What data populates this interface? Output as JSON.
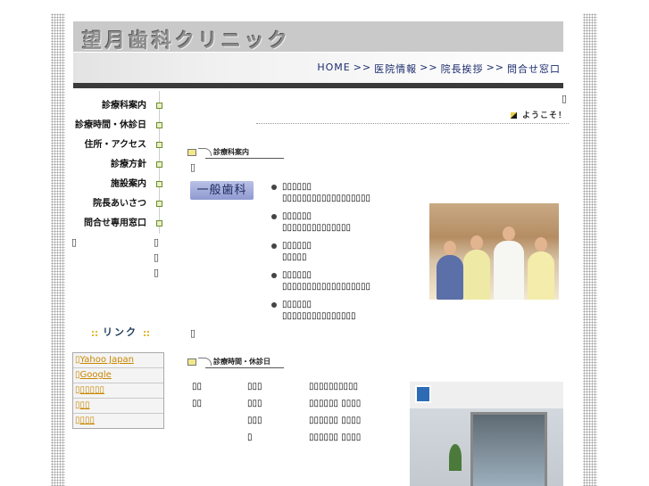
{
  "header": {
    "logo_text": "望月歯科クリニック",
    "nav": [
      {
        "label": "HOME"
      },
      {
        "label": "医院情報"
      },
      {
        "label": "院長挨拶"
      },
      {
        "label": "問合せ窓口"
      }
    ],
    "nav_separator": ">>"
  },
  "sidebar": {
    "menu": [
      {
        "label": "診療科案内"
      },
      {
        "label": "診療時間・休診日"
      },
      {
        "label": "住所・アクセス"
      },
      {
        "label": "診療方針"
      },
      {
        "label": "施設案内"
      },
      {
        "label": "院長あいさつ"
      },
      {
        "label": "問合せ専用窓口"
      }
    ],
    "links_title": "リンク",
    "links": [
      {
        "label": "Yahoo Japan",
        "prefix": "▯"
      },
      {
        "label": "Google",
        "prefix": "▯"
      },
      {
        "label": "▯▯▯▯▯",
        "prefix": "▯"
      },
      {
        "label": "▯▯",
        "prefix": "▯"
      },
      {
        "label": "▯▯▯",
        "prefix": "▯"
      }
    ]
  },
  "welcome": "ようこそ！",
  "sections": {
    "departments_title": "診療科案内",
    "hours_title": "診療時間・休診日"
  },
  "general_badge": "一般歯科",
  "services": [
    {
      "line1": "▯▯▯▯▯▯",
      "line2": "▯▯▯▯▯▯▯▯▯▯▯▯▯▯▯▯▯▯"
    },
    {
      "line1": "▯▯▯▯▯▯",
      "line2": "▯▯▯▯▯▯▯▯▯▯▯▯▯▯"
    },
    {
      "line1": "▯▯▯▯▯▯",
      "line2": "▯▯▯▯▯"
    },
    {
      "line1": "▯▯▯▯▯▯",
      "line2": "▯▯▯▯▯▯▯▯▯▯▯▯▯▯▯▯▯▯"
    },
    {
      "line1": "▯▯▯▯▯▯",
      "line2": "▯▯▯▯▯▯▯▯▯▯▯▯▯▯▯"
    }
  ],
  "hours": [
    {
      "c1": "▯▯",
      "c2": "▯▯▯",
      "c3": "▯▯▯▯▯▯▯▯▯▯"
    },
    {
      "c1": "▯▯",
      "c2": "▯▯▯",
      "c3": "▯▯▯▯▯▯ ▯▯▯▯"
    },
    {
      "c1": "",
      "c2": "▯▯▯",
      "c3": "▯▯▯▯▯▯ ▯▯▯▯"
    },
    {
      "c1": "",
      "c2": "▯",
      "c3": "▯▯▯▯▯▯ ▯▯▯▯"
    }
  ],
  "placeholder_glyph": "▯",
  "colors": {
    "nav_text": "#1c2e6e",
    "link_text": "#c88700",
    "banner": "#c9c9c9",
    "dark_rule": "#3a3a3a"
  }
}
